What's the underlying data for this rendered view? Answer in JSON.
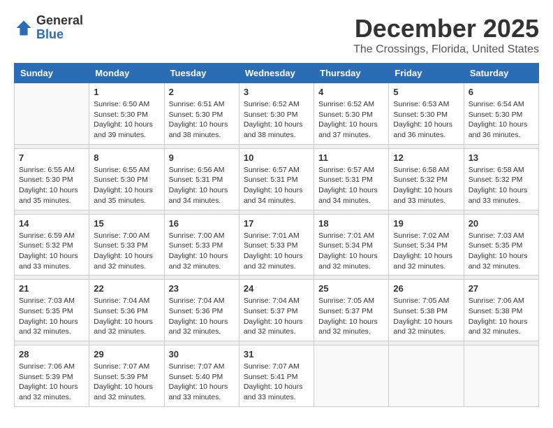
{
  "header": {
    "logo_general": "General",
    "logo_blue": "Blue",
    "month_title": "December 2025",
    "subtitle": "The Crossings, Florida, United States"
  },
  "weekdays": [
    "Sunday",
    "Monday",
    "Tuesday",
    "Wednesday",
    "Thursday",
    "Friday",
    "Saturday"
  ],
  "weeks": [
    [
      {
        "day": "",
        "info": ""
      },
      {
        "day": "1",
        "info": "Sunrise: 6:50 AM\nSunset: 5:30 PM\nDaylight: 10 hours\nand 39 minutes."
      },
      {
        "day": "2",
        "info": "Sunrise: 6:51 AM\nSunset: 5:30 PM\nDaylight: 10 hours\nand 38 minutes."
      },
      {
        "day": "3",
        "info": "Sunrise: 6:52 AM\nSunset: 5:30 PM\nDaylight: 10 hours\nand 38 minutes."
      },
      {
        "day": "4",
        "info": "Sunrise: 6:52 AM\nSunset: 5:30 PM\nDaylight: 10 hours\nand 37 minutes."
      },
      {
        "day": "5",
        "info": "Sunrise: 6:53 AM\nSunset: 5:30 PM\nDaylight: 10 hours\nand 36 minutes."
      },
      {
        "day": "6",
        "info": "Sunrise: 6:54 AM\nSunset: 5:30 PM\nDaylight: 10 hours\nand 36 minutes."
      }
    ],
    [
      {
        "day": "7",
        "info": "Sunrise: 6:55 AM\nSunset: 5:30 PM\nDaylight: 10 hours\nand 35 minutes."
      },
      {
        "day": "8",
        "info": "Sunrise: 6:55 AM\nSunset: 5:30 PM\nDaylight: 10 hours\nand 35 minutes."
      },
      {
        "day": "9",
        "info": "Sunrise: 6:56 AM\nSunset: 5:31 PM\nDaylight: 10 hours\nand 34 minutes."
      },
      {
        "day": "10",
        "info": "Sunrise: 6:57 AM\nSunset: 5:31 PM\nDaylight: 10 hours\nand 34 minutes."
      },
      {
        "day": "11",
        "info": "Sunrise: 6:57 AM\nSunset: 5:31 PM\nDaylight: 10 hours\nand 34 minutes."
      },
      {
        "day": "12",
        "info": "Sunrise: 6:58 AM\nSunset: 5:32 PM\nDaylight: 10 hours\nand 33 minutes."
      },
      {
        "day": "13",
        "info": "Sunrise: 6:58 AM\nSunset: 5:32 PM\nDaylight: 10 hours\nand 33 minutes."
      }
    ],
    [
      {
        "day": "14",
        "info": "Sunrise: 6:59 AM\nSunset: 5:32 PM\nDaylight: 10 hours\nand 33 minutes."
      },
      {
        "day": "15",
        "info": "Sunrise: 7:00 AM\nSunset: 5:33 PM\nDaylight: 10 hours\nand 32 minutes."
      },
      {
        "day": "16",
        "info": "Sunrise: 7:00 AM\nSunset: 5:33 PM\nDaylight: 10 hours\nand 32 minutes."
      },
      {
        "day": "17",
        "info": "Sunrise: 7:01 AM\nSunset: 5:33 PM\nDaylight: 10 hours\nand 32 minutes."
      },
      {
        "day": "18",
        "info": "Sunrise: 7:01 AM\nSunset: 5:34 PM\nDaylight: 10 hours\nand 32 minutes."
      },
      {
        "day": "19",
        "info": "Sunrise: 7:02 AM\nSunset: 5:34 PM\nDaylight: 10 hours\nand 32 minutes."
      },
      {
        "day": "20",
        "info": "Sunrise: 7:03 AM\nSunset: 5:35 PM\nDaylight: 10 hours\nand 32 minutes."
      }
    ],
    [
      {
        "day": "21",
        "info": "Sunrise: 7:03 AM\nSunset: 5:35 PM\nDaylight: 10 hours\nand 32 minutes."
      },
      {
        "day": "22",
        "info": "Sunrise: 7:04 AM\nSunset: 5:36 PM\nDaylight: 10 hours\nand 32 minutes."
      },
      {
        "day": "23",
        "info": "Sunrise: 7:04 AM\nSunset: 5:36 PM\nDaylight: 10 hours\nand 32 minutes."
      },
      {
        "day": "24",
        "info": "Sunrise: 7:04 AM\nSunset: 5:37 PM\nDaylight: 10 hours\nand 32 minutes."
      },
      {
        "day": "25",
        "info": "Sunrise: 7:05 AM\nSunset: 5:37 PM\nDaylight: 10 hours\nand 32 minutes."
      },
      {
        "day": "26",
        "info": "Sunrise: 7:05 AM\nSunset: 5:38 PM\nDaylight: 10 hours\nand 32 minutes."
      },
      {
        "day": "27",
        "info": "Sunrise: 7:06 AM\nSunset: 5:38 PM\nDaylight: 10 hours\nand 32 minutes."
      }
    ],
    [
      {
        "day": "28",
        "info": "Sunrise: 7:06 AM\nSunset: 5:39 PM\nDaylight: 10 hours\nand 32 minutes."
      },
      {
        "day": "29",
        "info": "Sunrise: 7:07 AM\nSunset: 5:39 PM\nDaylight: 10 hours\nand 32 minutes."
      },
      {
        "day": "30",
        "info": "Sunrise: 7:07 AM\nSunset: 5:40 PM\nDaylight: 10 hours\nand 33 minutes."
      },
      {
        "day": "31",
        "info": "Sunrise: 7:07 AM\nSunset: 5:41 PM\nDaylight: 10 hours\nand 33 minutes."
      },
      {
        "day": "",
        "info": ""
      },
      {
        "day": "",
        "info": ""
      },
      {
        "day": "",
        "info": ""
      }
    ]
  ]
}
